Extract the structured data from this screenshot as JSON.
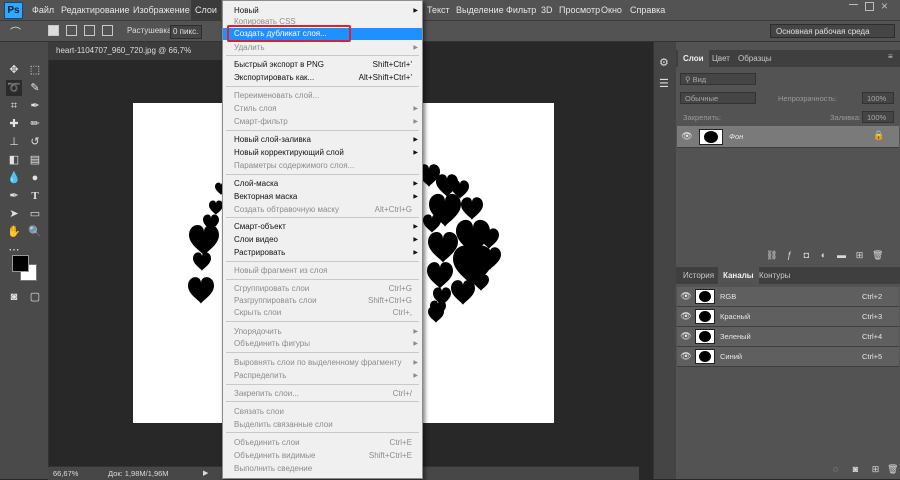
{
  "app": {
    "logo": "Ps"
  },
  "menubar": [
    "Файл",
    "Редактирование",
    "Изображение",
    "Слои",
    "Текст",
    "Выделение",
    "Фильтр",
    "3D",
    "Просмотр",
    "Окно",
    "Справка"
  ],
  "options": {
    "feather_label": "Растушевка:",
    "feather_value": "0 пикс.",
    "workspace": "Основная рабочая среда"
  },
  "document": {
    "tab_title": "heart-1104707_960_720.jpg @ 66,7% (RGB/8#)",
    "zoom": "66,67%",
    "doc_info": "Док: 1,98M/1,96M"
  },
  "layers_panel": {
    "tabs": [
      "Слои",
      "Цвет",
      "Образцы"
    ],
    "filter_placeholder": "Вид",
    "blend_mode": "Обычные",
    "opacity_label": "Непрозрачность:",
    "opacity_value": "100%",
    "lock_label": "Закрепить:",
    "fill_label": "Заливка:",
    "fill_value": "100%",
    "layer_name": "Фон"
  },
  "channels_panel": {
    "tabs": [
      "История",
      "Каналы",
      "Контуры"
    ],
    "rows": [
      {
        "name": "RGB",
        "shortcut": "Ctrl+2"
      },
      {
        "name": "Красный",
        "shortcut": "Ctrl+3"
      },
      {
        "name": "Зеленый",
        "shortcut": "Ctrl+4"
      },
      {
        "name": "Синий",
        "shortcut": "Ctrl+5"
      }
    ]
  },
  "layer_menu": [
    {
      "label": "Новый",
      "shortcut": "",
      "arrow": "▶",
      "state": "normal"
    },
    {
      "label": "Копировать CSS",
      "shortcut": "",
      "arrow": "",
      "state": "disabled"
    },
    {
      "label": "Создать дубликат слоя...",
      "shortcut": "",
      "arrow": "",
      "state": "highlighted"
    },
    {
      "label": "Удалить",
      "shortcut": "",
      "arrow": "▶",
      "state": "disabled"
    },
    {
      "label": "Быстрый экспорт в PNG",
      "shortcut": "Shift+Ctrl+'",
      "arrow": "",
      "state": "normal"
    },
    {
      "label": "Экспортировать как...",
      "shortcut": "Alt+Shift+Ctrl+'",
      "arrow": "",
      "state": "normal"
    },
    {
      "label": "Переименовать слой...",
      "shortcut": "",
      "arrow": "",
      "state": "disabled"
    },
    {
      "label": "Стиль слоя",
      "shortcut": "",
      "arrow": "▶",
      "state": "disabled"
    },
    {
      "label": "Смарт-фильтр",
      "shortcut": "",
      "arrow": "▶",
      "state": "disabled"
    },
    {
      "label": "Новый слой-заливка",
      "shortcut": "",
      "arrow": "▶",
      "state": "normal"
    },
    {
      "label": "Новый корректирующий слой",
      "shortcut": "",
      "arrow": "▶",
      "state": "normal"
    },
    {
      "label": "Параметры содержимого слоя...",
      "shortcut": "",
      "arrow": "",
      "state": "disabled"
    },
    {
      "label": "Слой-маска",
      "shortcut": "",
      "arrow": "▶",
      "state": "normal"
    },
    {
      "label": "Векторная маска",
      "shortcut": "",
      "arrow": "▶",
      "state": "normal"
    },
    {
      "label": "Создать обтравочную маску",
      "shortcut": "Alt+Ctrl+G",
      "arrow": "",
      "state": "disabled"
    },
    {
      "label": "Смарт-объект",
      "shortcut": "",
      "arrow": "▶",
      "state": "normal"
    },
    {
      "label": "Слои видео",
      "shortcut": "",
      "arrow": "▶",
      "state": "normal"
    },
    {
      "label": "Растрировать",
      "shortcut": "",
      "arrow": "▶",
      "state": "normal"
    },
    {
      "label": "Новый фрагмент из слоя",
      "shortcut": "",
      "arrow": "",
      "state": "disabled"
    },
    {
      "label": "Сгруппировать слои",
      "shortcut": "Ctrl+G",
      "arrow": "",
      "state": "disabled"
    },
    {
      "label": "Разгруппировать слои",
      "shortcut": "Shift+Ctrl+G",
      "arrow": "",
      "state": "disabled"
    },
    {
      "label": "Скрыть слои",
      "shortcut": "Ctrl+,",
      "arrow": "",
      "state": "disabled"
    },
    {
      "label": "Упорядочить",
      "shortcut": "",
      "arrow": "▶",
      "state": "disabled"
    },
    {
      "label": "Объединить фигуры",
      "shortcut": "",
      "arrow": "▶",
      "state": "disabled"
    },
    {
      "label": "Выровнять слои по выделенному фрагменту",
      "shortcut": "",
      "arrow": "▶",
      "state": "disabled"
    },
    {
      "label": "Распределить",
      "shortcut": "",
      "arrow": "▶",
      "state": "disabled"
    },
    {
      "label": "Закрепить слои...",
      "shortcut": "Ctrl+/",
      "arrow": "",
      "state": "disabled"
    },
    {
      "label": "Связать слои",
      "shortcut": "",
      "arrow": "",
      "state": "disabled"
    },
    {
      "label": "Выделить связанные слои",
      "shortcut": "",
      "arrow": "",
      "state": "disabled"
    },
    {
      "label": "Объединить слои",
      "shortcut": "Ctrl+E",
      "arrow": "",
      "state": "disabled"
    },
    {
      "label": "Объединить видимые",
      "shortcut": "Shift+Ctrl+E",
      "arrow": "",
      "state": "disabled"
    },
    {
      "label": "Выполнить сведение",
      "shortcut": "",
      "arrow": "",
      "state": "disabled"
    }
  ],
  "colors": {
    "highlight": "#1e90ff",
    "callout": "#e0202a",
    "ps_blue": "#31a8ff"
  }
}
